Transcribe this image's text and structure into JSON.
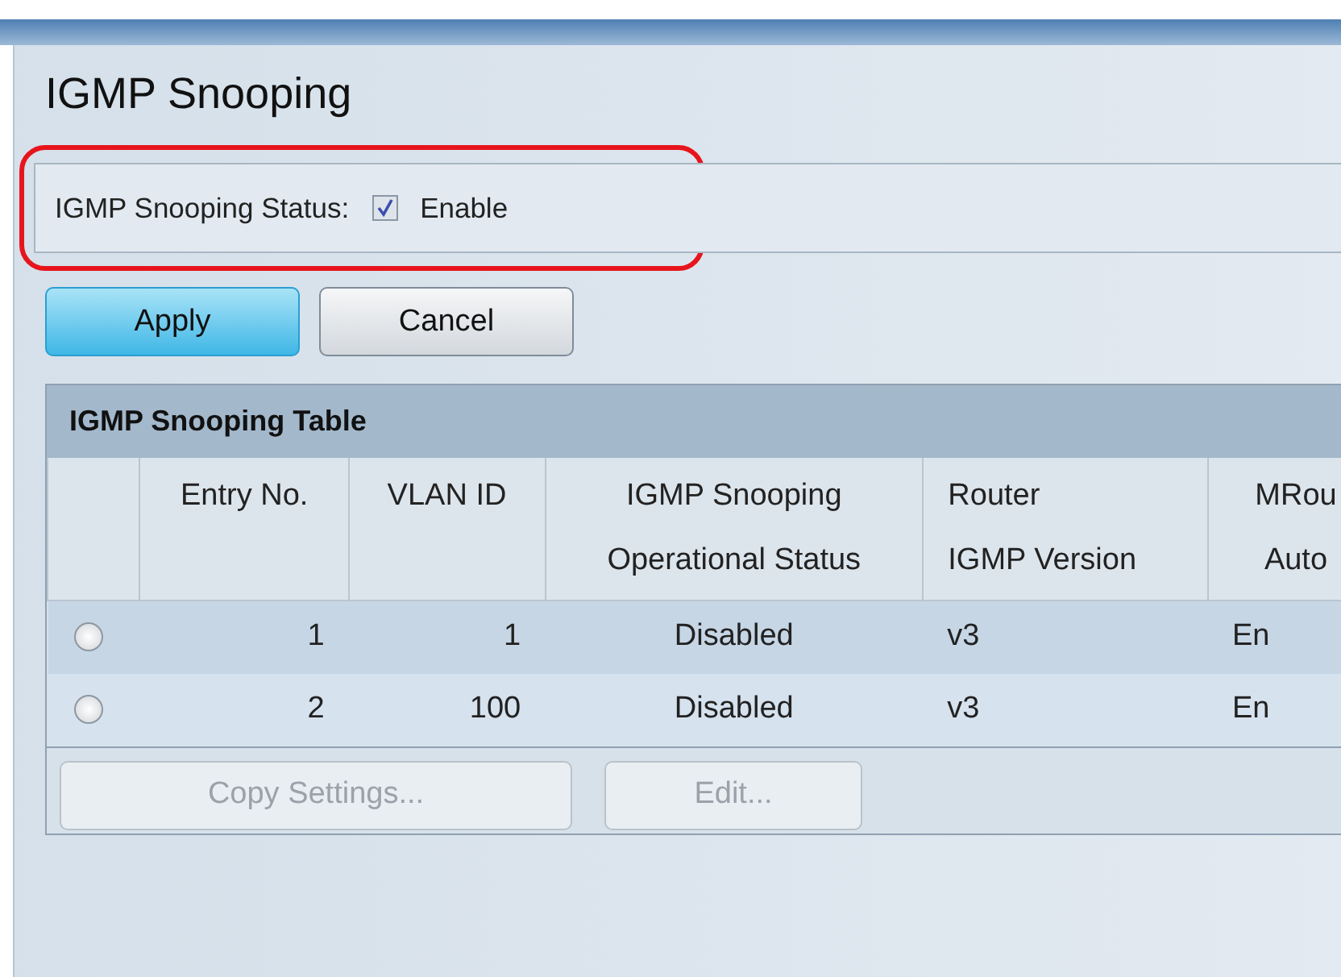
{
  "page_title": "IGMP Snooping",
  "status": {
    "label": "IGMP Snooping Status:",
    "checked": true,
    "option": "Enable",
    "highlighted": true
  },
  "buttons": [
    {
      "label": "Apply",
      "kind": "primary"
    },
    {
      "label": "Cancel",
      "kind": "normal"
    }
  ],
  "table": {
    "title": "IGMP Snooping Table",
    "columns": [
      {
        "kind": "select"
      },
      {
        "lines": [
          "Entry No."
        ]
      },
      {
        "lines": [
          "VLAN ID"
        ]
      },
      {
        "lines": [
          "IGMP Snooping",
          "Operational Status"
        ]
      },
      {
        "lines": [
          "Router",
          "IGMP Version"
        ]
      },
      {
        "lines": [
          "MRou",
          "Auto"
        ]
      }
    ],
    "rows": [
      {
        "cells": [
          {
            "kind": "radio",
            "selected": false
          },
          "1",
          "1",
          "Disabled",
          "v3",
          "En"
        ]
      },
      {
        "cells": [
          {
            "kind": "radio",
            "selected": false
          },
          "2",
          "100",
          "Disabled",
          "v3",
          "En"
        ]
      }
    ],
    "actions": [
      {
        "label": "Copy Settings...",
        "disabled": true
      },
      {
        "label": "Edit...",
        "disabled": true
      }
    ]
  }
}
